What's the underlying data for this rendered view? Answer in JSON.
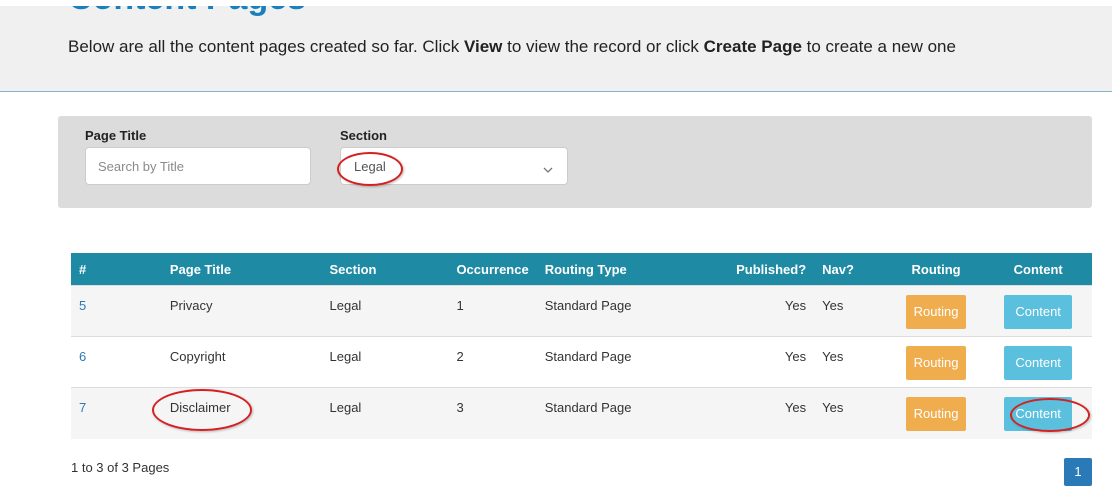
{
  "header": {
    "title": "Content Pages",
    "intro_part1": "Below are all the content pages created so far. Click ",
    "intro_view": "View",
    "intro_part2": " to view the record or click ",
    "intro_create": "Create Page",
    "intro_part3": " to create a new one"
  },
  "filters": {
    "title_label": "Page Title",
    "title_placeholder": "Search by Title",
    "section_label": "Section",
    "section_value": "Legal"
  },
  "table": {
    "headers": [
      "#",
      "Page Title",
      "Section",
      "Occurrence",
      "Routing Type",
      "Published?",
      "Nav?",
      "Routing",
      "Content"
    ],
    "rows": [
      {
        "id": "5",
        "title": "Privacy",
        "section": "Legal",
        "occurrence": "1",
        "routing_type": "Standard Page",
        "published": "Yes",
        "nav": "Yes",
        "routing_btn": "Routing",
        "content_btn": "Content"
      },
      {
        "id": "6",
        "title": "Copyright",
        "section": "Legal",
        "occurrence": "2",
        "routing_type": "Standard Page",
        "published": "Yes",
        "nav": "Yes",
        "routing_btn": "Routing",
        "content_btn": "Content"
      },
      {
        "id": "7",
        "title": "Disclaimer",
        "section": "Legal",
        "occurrence": "3",
        "routing_type": "Standard Page",
        "published": "Yes",
        "nav": "Yes",
        "routing_btn": "Routing",
        "content_btn": "Content"
      }
    ]
  },
  "footer": {
    "count_text": "1 to 3 of 3 Pages",
    "page_number": "1"
  },
  "colors": {
    "title": "#1a80bd",
    "table_header": "#1f8aa3",
    "routing_button": "#f0ad4e",
    "content_button": "#5bc0de",
    "annotation": "#d42020"
  },
  "icons": {
    "select_arrow": "chevron-down-icon"
  }
}
